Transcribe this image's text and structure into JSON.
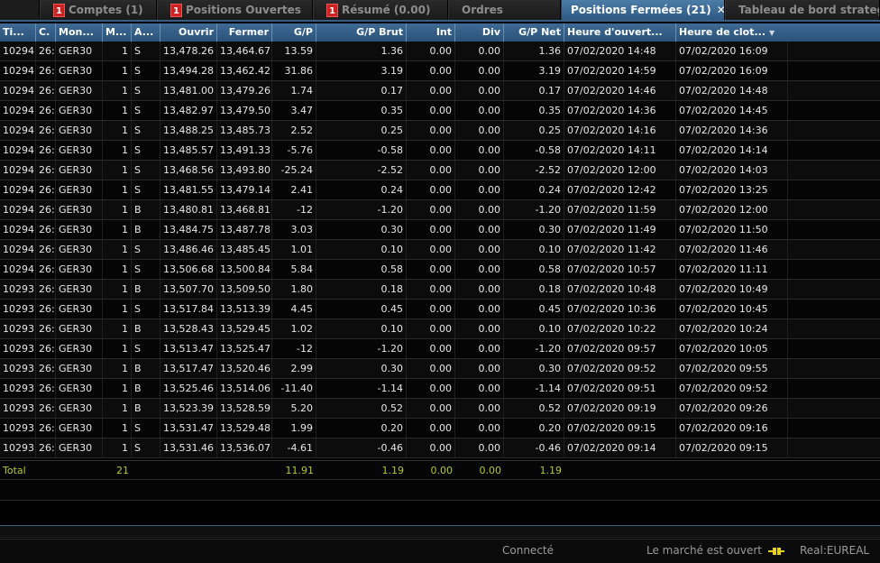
{
  "tabs": [
    {
      "label": "Comptes (1)",
      "badge": "1"
    },
    {
      "label": "Positions Ouvertes",
      "badge": "1"
    },
    {
      "label": "Résumé (0.00)",
      "badge": "1"
    },
    {
      "label": "Ordres",
      "badge": ""
    },
    {
      "label": "Positions Fermées (21)",
      "badge": "",
      "active": true,
      "close": "✕"
    },
    {
      "label": "Tableau de bord strateg",
      "badge": ""
    }
  ],
  "columns": [
    "Ti...",
    "C.",
    "Mon...",
    "M...",
    "A...",
    "Ouvrir",
    "Fermer",
    "G/P",
    "G/P Brut",
    "Int",
    "Div",
    "G/P Net",
    "Heure d'ouvert...",
    "Heure de clot..."
  ],
  "rows": [
    [
      "10294",
      "26:",
      "GER30",
      "1",
      "S",
      "13,478.26",
      "13,464.67",
      "13.59",
      "1.36",
      "0.00",
      "0.00",
      "1.36",
      "07/02/2020 14:48",
      "07/02/2020 16:09"
    ],
    [
      "10294",
      "26:",
      "GER30",
      "1",
      "S",
      "13,494.28",
      "13,462.42",
      "31.86",
      "3.19",
      "0.00",
      "0.00",
      "3.19",
      "07/02/2020 14:59",
      "07/02/2020 16:09"
    ],
    [
      "10294",
      "26:",
      "GER30",
      "1",
      "S",
      "13,481.00",
      "13,479.26",
      "1.74",
      "0.17",
      "0.00",
      "0.00",
      "0.17",
      "07/02/2020 14:46",
      "07/02/2020 14:48"
    ],
    [
      "10294",
      "26:",
      "GER30",
      "1",
      "S",
      "13,482.97",
      "13,479.50",
      "3.47",
      "0.35",
      "0.00",
      "0.00",
      "0.35",
      "07/02/2020 14:36",
      "07/02/2020 14:45"
    ],
    [
      "10294",
      "26:",
      "GER30",
      "1",
      "S",
      "13,488.25",
      "13,485.73",
      "2.52",
      "0.25",
      "0.00",
      "0.00",
      "0.25",
      "07/02/2020 14:16",
      "07/02/2020 14:36"
    ],
    [
      "10294",
      "26:",
      "GER30",
      "1",
      "S",
      "13,485.57",
      "13,491.33",
      "-5.76",
      "-0.58",
      "0.00",
      "0.00",
      "-0.58",
      "07/02/2020 14:11",
      "07/02/2020 14:14"
    ],
    [
      "10294",
      "26:",
      "GER30",
      "1",
      "S",
      "13,468.56",
      "13,493.80",
      "-25.24",
      "-2.52",
      "0.00",
      "0.00",
      "-2.52",
      "07/02/2020 12:00",
      "07/02/2020 14:03"
    ],
    [
      "10294",
      "26:",
      "GER30",
      "1",
      "S",
      "13,481.55",
      "13,479.14",
      "2.41",
      "0.24",
      "0.00",
      "0.00",
      "0.24",
      "07/02/2020 12:42",
      "07/02/2020 13:25"
    ],
    [
      "10294",
      "26:",
      "GER30",
      "1",
      "B",
      "13,480.81",
      "13,468.81",
      "-12",
      "-1.20",
      "0.00",
      "0.00",
      "-1.20",
      "07/02/2020 11:59",
      "07/02/2020 12:00"
    ],
    [
      "10294",
      "26:",
      "GER30",
      "1",
      "B",
      "13,484.75",
      "13,487.78",
      "3.03",
      "0.30",
      "0.00",
      "0.00",
      "0.30",
      "07/02/2020 11:49",
      "07/02/2020 11:50"
    ],
    [
      "10294",
      "26:",
      "GER30",
      "1",
      "S",
      "13,486.46",
      "13,485.45",
      "1.01",
      "0.10",
      "0.00",
      "0.00",
      "0.10",
      "07/02/2020 11:42",
      "07/02/2020 11:46"
    ],
    [
      "10294",
      "26:",
      "GER30",
      "1",
      "S",
      "13,506.68",
      "13,500.84",
      "5.84",
      "0.58",
      "0.00",
      "0.00",
      "0.58",
      "07/02/2020 10:57",
      "07/02/2020 11:11"
    ],
    [
      "10293",
      "26:",
      "GER30",
      "1",
      "B",
      "13,507.70",
      "13,509.50",
      "1.80",
      "0.18",
      "0.00",
      "0.00",
      "0.18",
      "07/02/2020 10:48",
      "07/02/2020 10:49"
    ],
    [
      "10293",
      "26:",
      "GER30",
      "1",
      "S",
      "13,517.84",
      "13,513.39",
      "4.45",
      "0.45",
      "0.00",
      "0.00",
      "0.45",
      "07/02/2020 10:36",
      "07/02/2020 10:45"
    ],
    [
      "10293",
      "26:",
      "GER30",
      "1",
      "B",
      "13,528.43",
      "13,529.45",
      "1.02",
      "0.10",
      "0.00",
      "0.00",
      "0.10",
      "07/02/2020 10:22",
      "07/02/2020 10:24"
    ],
    [
      "10293",
      "26:",
      "GER30",
      "1",
      "S",
      "13,513.47",
      "13,525.47",
      "-12",
      "-1.20",
      "0.00",
      "0.00",
      "-1.20",
      "07/02/2020 09:57",
      "07/02/2020 10:05"
    ],
    [
      "10293",
      "26:",
      "GER30",
      "1",
      "B",
      "13,517.47",
      "13,520.46",
      "2.99",
      "0.30",
      "0.00",
      "0.00",
      "0.30",
      "07/02/2020 09:52",
      "07/02/2020 09:55"
    ],
    [
      "10293",
      "26:",
      "GER30",
      "1",
      "B",
      "13,525.46",
      "13,514.06",
      "-11.40",
      "-1.14",
      "0.00",
      "0.00",
      "-1.14",
      "07/02/2020 09:51",
      "07/02/2020 09:52"
    ],
    [
      "10293",
      "26:",
      "GER30",
      "1",
      "B",
      "13,523.39",
      "13,528.59",
      "5.20",
      "0.52",
      "0.00",
      "0.00",
      "0.52",
      "07/02/2020 09:19",
      "07/02/2020 09:26"
    ],
    [
      "10293",
      "26:",
      "GER30",
      "1",
      "S",
      "13,531.47",
      "13,529.48",
      "1.99",
      "0.20",
      "0.00",
      "0.00",
      "0.20",
      "07/02/2020 09:15",
      "07/02/2020 09:16"
    ],
    [
      "10293",
      "26:",
      "GER30",
      "1",
      "S",
      "13,531.46",
      "13,536.07",
      "-4.61",
      "-0.46",
      "0.00",
      "0.00",
      "-0.46",
      "07/02/2020 09:14",
      "07/02/2020 09:15"
    ]
  ],
  "total": {
    "label": "Total",
    "amount": "21",
    "gp": "11.91",
    "gp_brut": "1.19",
    "int": "0.00",
    "div": "0.00",
    "gp_net": "1.19"
  },
  "status": {
    "connection": "Connecté",
    "market": "Le marché est ouvert",
    "account": "Real:EUREAL"
  },
  "icons": {
    "sort": "sort-desc-icon",
    "plug": "plug-icon",
    "close": "close-icon"
  },
  "colors": {
    "accent": "#3d6a94",
    "total_text": "#b6c92a",
    "badge": "#cc2222"
  }
}
